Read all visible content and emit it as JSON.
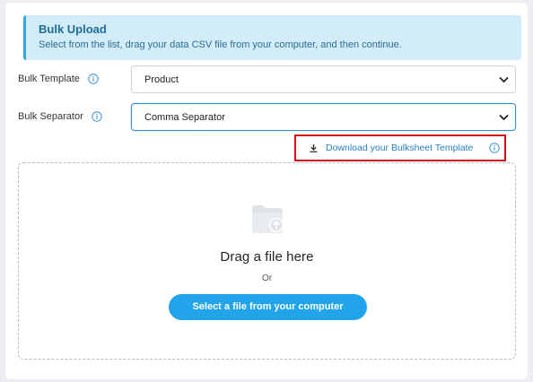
{
  "notice": {
    "title": "Bulk Upload",
    "text": "Select from the list, drag your data CSV file from your computer, and then continue."
  },
  "fields": {
    "template_label": "Bulk Template",
    "template_value": "Product",
    "separator_label": "Bulk Separator",
    "separator_value": "Comma Separator"
  },
  "download": {
    "label": "Download your Bulksheet Template",
    "icon": "download-icon"
  },
  "dropzone": {
    "title": "Drag a file here",
    "or": "Or",
    "button_label": "Select a file from your computer",
    "icon": "folder-upload-icon"
  },
  "colors": {
    "accent": "#22a4ea",
    "notice_bg": "#d2ecf9",
    "highlight": "#d0101d"
  }
}
